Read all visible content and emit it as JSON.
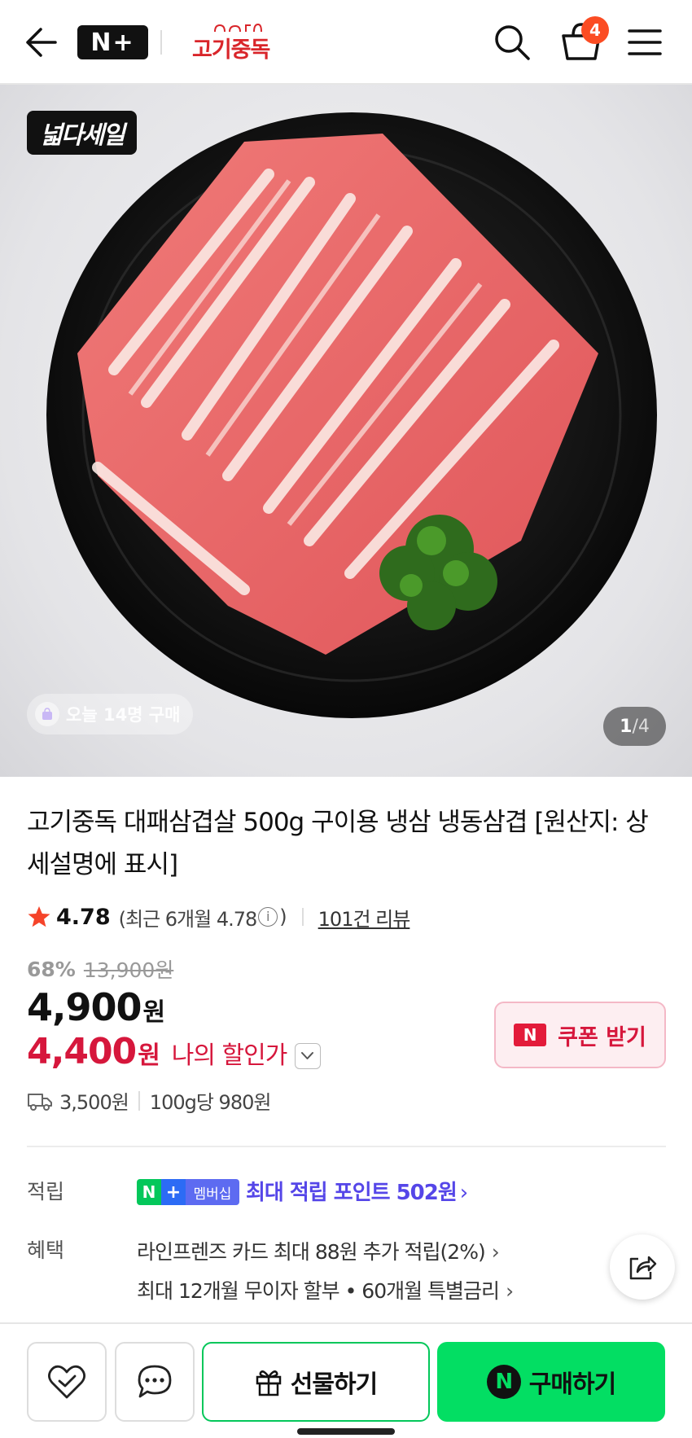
{
  "header": {
    "nplus_logo": "N+",
    "store_logo_text": "고기중독",
    "cart_count": "4",
    "icons": [
      "back-arrow-icon",
      "search-icon",
      "cart-icon",
      "menu-icon"
    ]
  },
  "hero": {
    "sale_badge": "넓다세일",
    "buyers_today": "오늘 14명 구매",
    "page_current": "1",
    "page_separator": "/",
    "page_total": "4"
  },
  "product": {
    "title": "고기중독 대패삼겹살 500g 구이용 냉삼 냉동삼겹 [원산지: 상세설명에 표시]",
    "rating": "4.78",
    "rating_recent_prefix": "(최근 6개월 4.78",
    "rating_recent_suffix": ")",
    "info_glyph": "i",
    "review_count": "101건 리뷰",
    "discount_rate": "68%",
    "original_price": "13,900원",
    "price": "4,900",
    "price_unit": "원",
    "my_price": "4,400",
    "my_price_unit": "원",
    "my_price_label": "나의 할인가",
    "coupon_button": "쿠폰 받기",
    "shipping_fee": "3,500원",
    "unit_price": "100g당 980원"
  },
  "points": {
    "label": "적립",
    "badge_n": "N",
    "badge_plus": "+",
    "badge_text": "멤버십",
    "text": "최대 적립 포인트 502원",
    "arrow": "›"
  },
  "benefits": {
    "label": "혜택",
    "items": [
      "라인프렌즈 카드 최대 88원 추가 적립(2%)",
      "최대 12개월 무이자 할부 • 60개월 특별금리"
    ],
    "arrow": "›"
  },
  "bottom_bar": {
    "gift_label": "선물하기",
    "buy_label": "구매하기",
    "buy_icon_letter": "N"
  },
  "colors": {
    "accent_red": "#d6173c",
    "naver_green": "#03c75a",
    "buy_green": "#03de63",
    "points_purple": "#5546e8",
    "badge_orange": "#fb4c23"
  }
}
